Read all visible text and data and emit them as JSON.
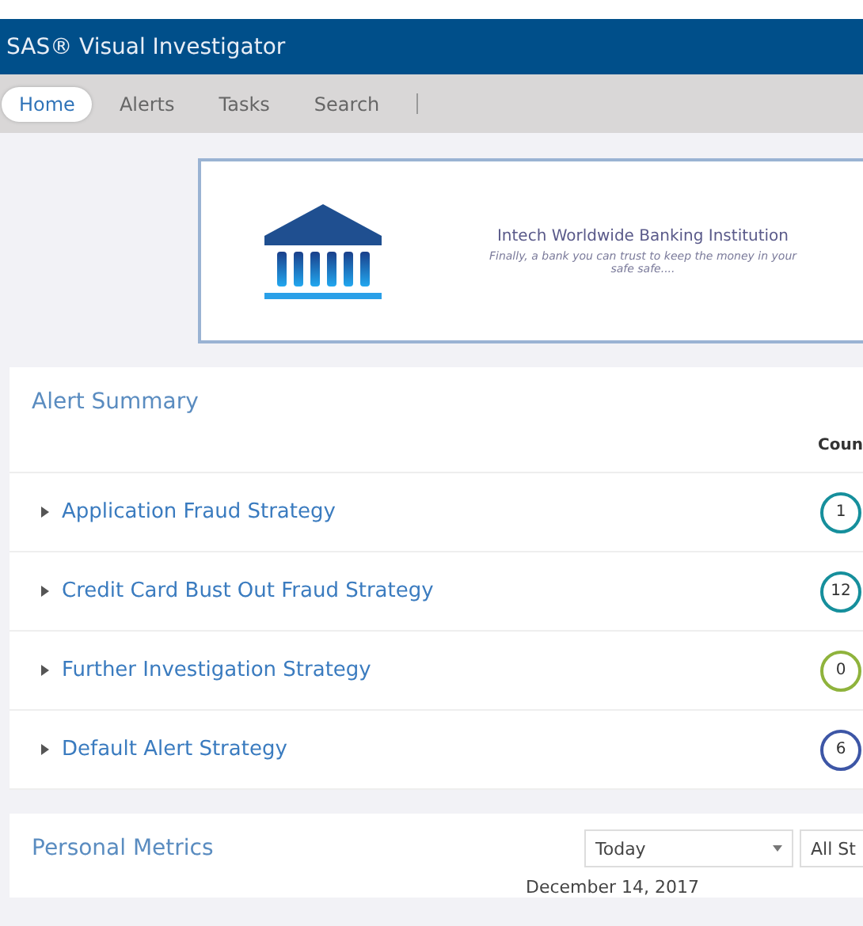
{
  "window": {
    "title": "SAS® Visual Investigator"
  },
  "tabs": [
    {
      "label": "Home",
      "selected": true
    },
    {
      "label": "Alerts",
      "selected": false
    },
    {
      "label": "Tasks",
      "selected": false
    },
    {
      "label": "Search",
      "selected": false
    }
  ],
  "banner": {
    "title": "Intech Worldwide Banking Institution",
    "tagline": "Finally, a bank you can trust to keep the money in your safe safe...."
  },
  "alert_summary": {
    "title": "Alert Summary",
    "count_header": "Coun",
    "rows": [
      {
        "name": "Application Fraud Strategy",
        "count": "1",
        "color": "#168f9c"
      },
      {
        "name": "Credit Card Bust Out Fraud Strategy",
        "count": "12",
        "color": "#168f9c"
      },
      {
        "name": "Further Investigation Strategy",
        "count": "0",
        "color": "#8fb33c"
      },
      {
        "name": "Default Alert Strategy",
        "count": "6",
        "color": "#3d56a6"
      }
    ]
  },
  "personal_metrics": {
    "title": "Personal Metrics",
    "period": "Today",
    "status": "All St",
    "date": "December 14, 2017"
  }
}
